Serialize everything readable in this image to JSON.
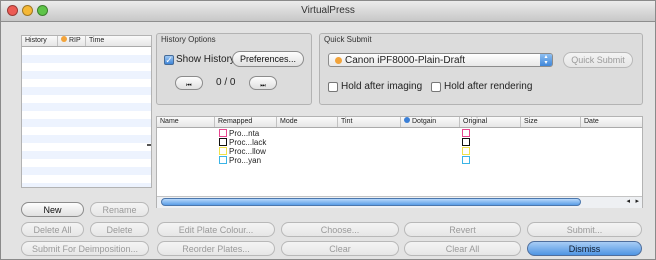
{
  "window": {
    "title": "VirtualPress"
  },
  "history": {
    "columns": [
      "History",
      "RIP",
      "Time"
    ],
    "buttons": {
      "new": "New",
      "rename": "Rename"
    }
  },
  "history_options": {
    "group_title": "History Options",
    "show_history": "Show History",
    "show_history_checked": true,
    "preferences": "Preferences...",
    "nav_first": "⏮",
    "nav_last": "⏭",
    "counter": "0 / 0"
  },
  "quick_submit": {
    "group_title": "Quick Submit",
    "device": "Canon iPF8000-Plain-Draft",
    "submit": "Quick Submit",
    "hold_imaging": "Hold after imaging",
    "hold_rendering": "Hold after rendering"
  },
  "plates": {
    "columns": [
      "Name",
      "Remapped",
      "Mode",
      "Tint",
      "Dotgain",
      "Original",
      "Size",
      "Date"
    ],
    "rows": [
      {
        "remapped": "Pro...nta",
        "color": "#e8468f"
      },
      {
        "remapped": "Proc...lack",
        "color": "#111111"
      },
      {
        "remapped": "Proc...llow",
        "color": "#f0e14a"
      },
      {
        "remapped": "Pro...yan",
        "color": "#3bb4e6"
      }
    ]
  },
  "buttons": {
    "delete_all": "Delete All",
    "delete": "Delete",
    "edit_plate_colour": "Edit Plate Colour...",
    "choose": "Choose...",
    "revert": "Revert",
    "submit": "Submit...",
    "submit_deimposition": "Submit For Deimposition...",
    "reorder_plates": "Reorder Plates...",
    "clear": "Clear",
    "clear_all": "Clear All",
    "dismiss": "Dismiss"
  },
  "colors": {
    "accent": "#3f86d8",
    "close": "#ec5b54",
    "minimize": "#f5b836",
    "zoom": "#5ec448",
    "rip_dot": "#f2a33a",
    "dotgain_dot": "#3b7fd6"
  }
}
